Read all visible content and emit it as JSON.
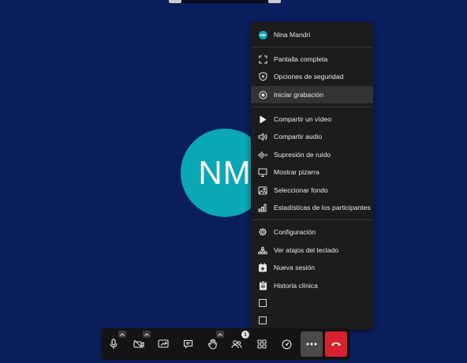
{
  "participant": {
    "initials": "NM"
  },
  "menu": {
    "user": {
      "badge": "NM",
      "name": "Nina Mandri"
    },
    "items": [
      {
        "label": "Pantalla completa",
        "icon": "fullscreen-icon"
      },
      {
        "label": "Opciones de seguridad",
        "icon": "shield-icon"
      },
      {
        "label": "Iniciar grabación",
        "icon": "record-icon"
      },
      {
        "label": "Compartir un vídeo",
        "icon": "play-icon"
      },
      {
        "label": "Compartir audio",
        "icon": "speaker-icon"
      },
      {
        "label": "Supresión de ruido",
        "icon": "noise-suppression-icon"
      },
      {
        "label": "Mostrar pizarra",
        "icon": "whiteboard-icon"
      },
      {
        "label": "Seleccionar fondo",
        "icon": "image-icon"
      },
      {
        "label": "Estadísticas de los participantes",
        "icon": "bar-chart-icon"
      },
      {
        "label": "Configuración",
        "icon": "gear-icon"
      },
      {
        "label": "Ver atajos del teclado",
        "icon": "keyboard-shortcuts-icon"
      },
      {
        "label": "Nueva sesión",
        "icon": "calendar-add-icon"
      },
      {
        "label": "Historia clínica",
        "icon": "clipboard-icon"
      }
    ]
  },
  "toolbar": {
    "participants_count": "1",
    "buttons": [
      "microphone-icon",
      "camera-off-icon",
      "share-screen-icon",
      "chat-icon",
      "raise-hand-icon",
      "participants-icon",
      "tile-view-icon",
      "speed-icon",
      "more-icon",
      "hangup-icon"
    ]
  },
  "colors": {
    "background": "#0a1e5e",
    "avatar": "#0aa7b5",
    "menu_bg": "#1c1c1c",
    "menu_active": "#333333",
    "hangup": "#d8212f"
  }
}
